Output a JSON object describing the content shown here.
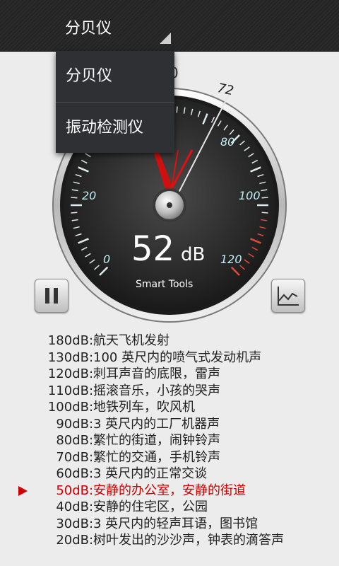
{
  "topbar": {
    "spinner_label": "分贝仪"
  },
  "menu": {
    "items": [
      "分贝仪",
      "振动检测仪"
    ]
  },
  "gauge": {
    "reading_value": "52",
    "reading_unit": "dB",
    "brand": "Smart Tools",
    "scale_labels": [
      "0",
      "20",
      "80",
      "100",
      "120"
    ],
    "peak_marker": "72",
    "top_partial_label": "0"
  },
  "controls": {
    "pause": "pause-icon",
    "graph": "line-graph-icon"
  },
  "levels": [
    {
      "db": "180dB",
      "desc": "航天飞机发射"
    },
    {
      "db": "130dB",
      "desc": "100 英尺内的喷气式发动机声"
    },
    {
      "db": "120dB",
      "desc": "刺耳声音的底限，雷声"
    },
    {
      "db": "110dB",
      "desc": "摇滚音乐，小孩的哭声"
    },
    {
      "db": "100dB",
      "desc": "地铁列车，吹风机"
    },
    {
      "db": "90dB",
      "desc": "3 英尺内的工厂机器声"
    },
    {
      "db": "80dB",
      "desc": "繁忙的街道，闹钟铃声"
    },
    {
      "db": "70dB",
      "desc": "繁忙的交通，手机铃声"
    },
    {
      "db": "60dB",
      "desc": "3 英尺内的正常交谈"
    },
    {
      "db": "50dB",
      "desc": "安静的办公室，安静的街道"
    },
    {
      "db": "40dB",
      "desc": "安静的住宅区，公园"
    },
    {
      "db": "30dB",
      "desc": "3 英尺内的轻声耳语，图书馆"
    },
    {
      "db": "20dB",
      "desc": "树叶发出的沙沙声，钟表的滴答声"
    }
  ],
  "separator": ":",
  "colors": {
    "active": "#d10000",
    "needle": "#e01010",
    "scale_text": "#bfeef2"
  }
}
